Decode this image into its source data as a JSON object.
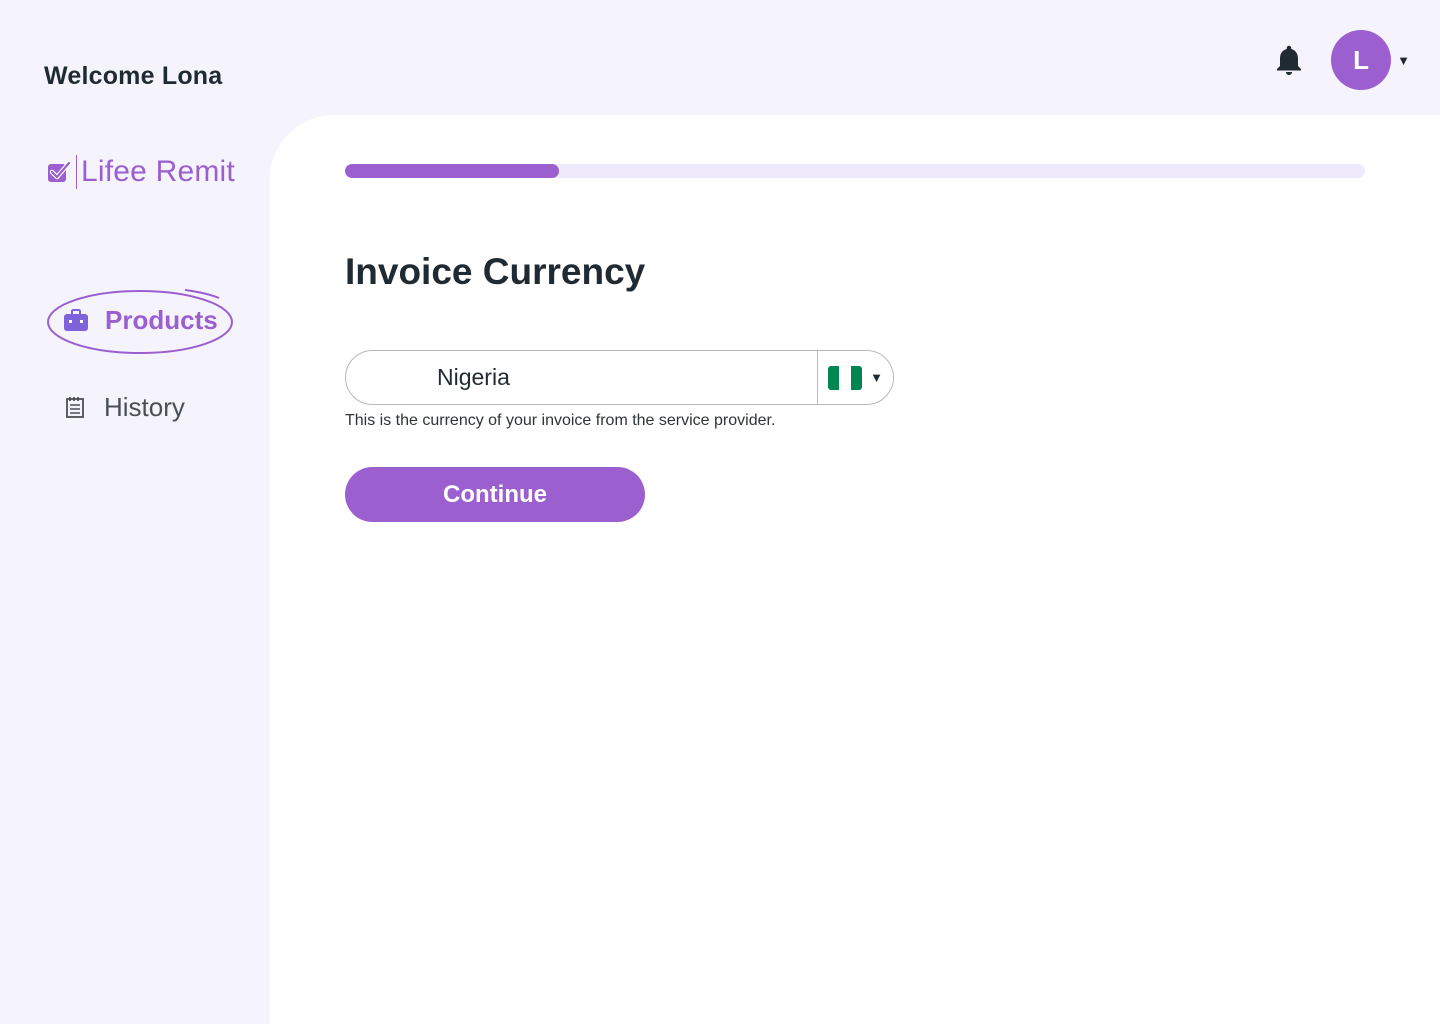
{
  "header": {
    "welcome": "Welcome Lona",
    "avatar_initial": "L",
    "bell_icon": "bell-icon",
    "menu_caret": "▼"
  },
  "sidebar": {
    "brand": "Lifee Remit",
    "items": [
      {
        "label": "Products",
        "icon": "briefcase-icon",
        "active": true
      },
      {
        "label": "History",
        "icon": "document-list-icon",
        "active": false
      }
    ]
  },
  "main": {
    "progress_percent": 21,
    "title": "Invoice Currency",
    "currency_select": {
      "value": "Nigeria",
      "flag": "nigeria-flag-icon",
      "caret": "▼"
    },
    "helper_text": "This is the currency of your invoice from the service provider.",
    "continue_label": "Continue"
  },
  "colors": {
    "accent": "#9b5fcf",
    "background": "#f5f3fc",
    "progress_track": "#eeeafb",
    "flag_green": "#008751"
  }
}
